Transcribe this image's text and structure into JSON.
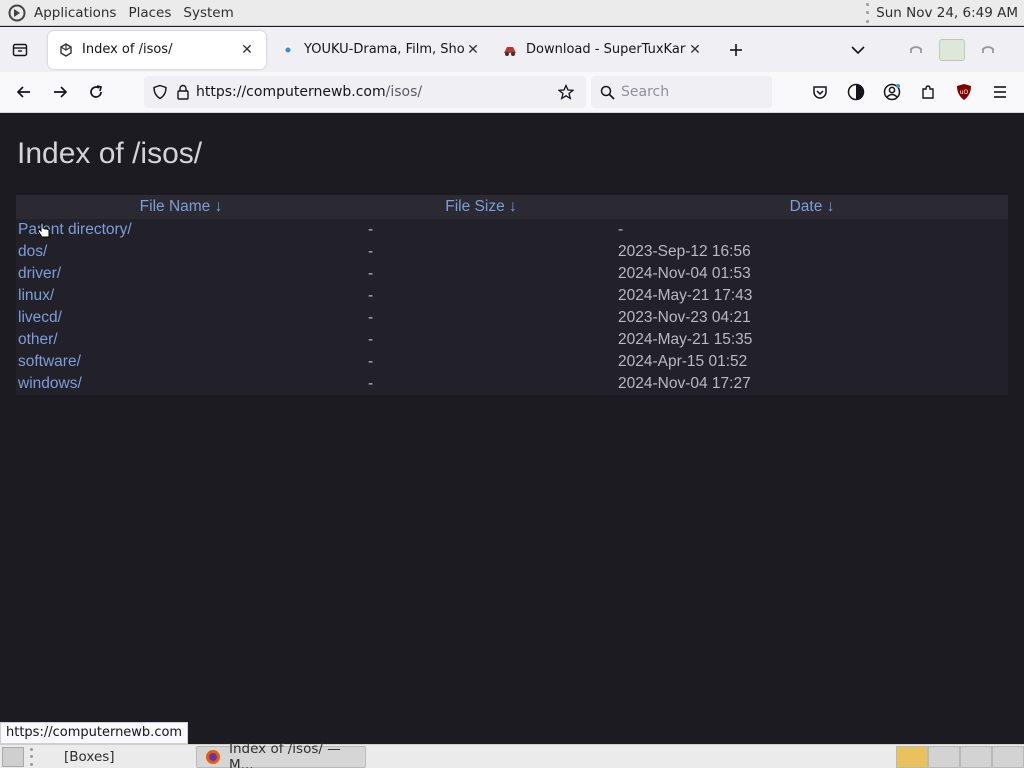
{
  "top_panel": {
    "menus": [
      "Applications",
      "Places",
      "System"
    ],
    "clock": "Sun Nov 24,  6:49 AM"
  },
  "tabs": [
    {
      "title": "Index of /isos/",
      "active": true
    },
    {
      "title": "YOUKU-Drama, Film, Show",
      "active": false
    },
    {
      "title": "Download - SuperTuxKart",
      "active": false
    }
  ],
  "nav": {
    "url_host": "https://computernewb.com",
    "url_path": "/isos/",
    "search_placeholder": "Search"
  },
  "page": {
    "heading": "Index of /isos/",
    "columns": [
      "File Name ↓",
      "File Size ↓",
      "Date ↓"
    ],
    "rows": [
      {
        "name": "Parent directory/",
        "size": "-",
        "date": "-"
      },
      {
        "name": "dos/",
        "size": "-",
        "date": "2023-Sep-12 16:56"
      },
      {
        "name": "driver/",
        "size": "-",
        "date": "2024-Nov-04 01:53"
      },
      {
        "name": "linux/",
        "size": "-",
        "date": "2024-May-21 17:43"
      },
      {
        "name": "livecd/",
        "size": "-",
        "date": "2023-Nov-23 04:21"
      },
      {
        "name": "other/",
        "size": "-",
        "date": "2024-May-21 15:35"
      },
      {
        "name": "software/",
        "size": "-",
        "date": "2024-Apr-15 01:52"
      },
      {
        "name": "windows/",
        "size": "-",
        "date": "2024-Nov-04 17:27"
      }
    ]
  },
  "status_tip": "https://computernewb.com",
  "bottom_panel": {
    "tasks": [
      "[Boxes]",
      "Index of /isos/ — M..."
    ]
  },
  "colors": {
    "page_bg": "#1c1b22",
    "link": "#7d9ed9",
    "text": "#b9b9c0"
  }
}
